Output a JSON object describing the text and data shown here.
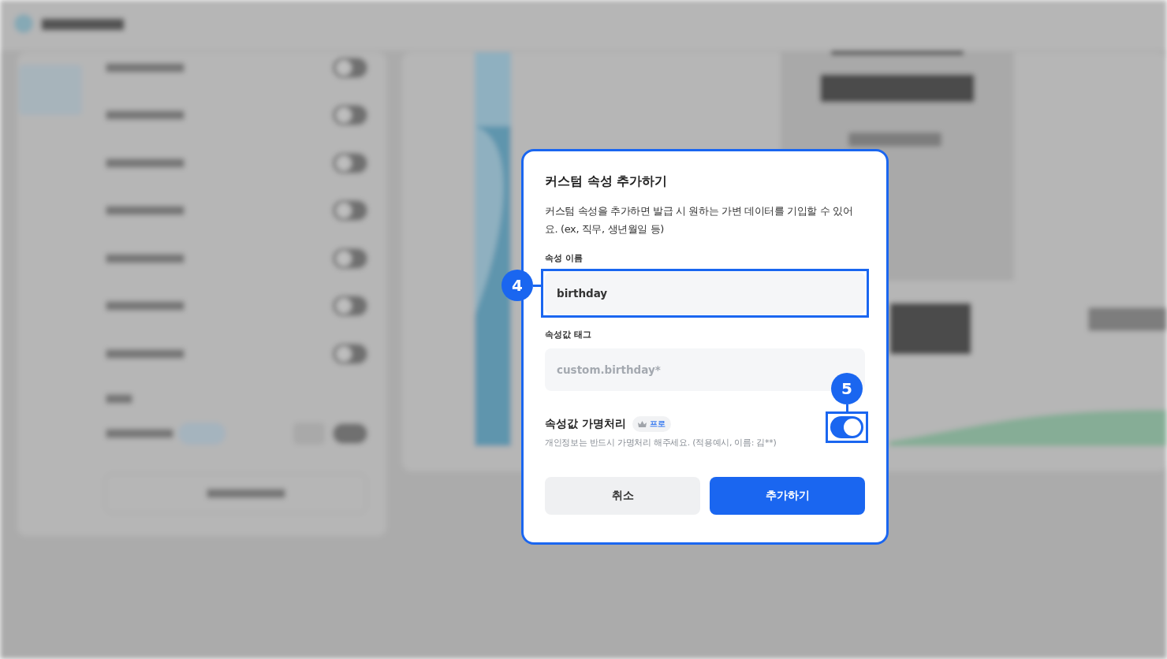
{
  "dialog": {
    "title": "커스텀 속성 추가하기",
    "description": "커스텀 속성을 추가하면 발급 시 원하는 가변 데이터를 기입할 수 있어요. (ex, 직무, 생년월일 등)",
    "fields": [
      {
        "label": "속성 이름",
        "value": "birthday",
        "highlighted": true,
        "step": "4"
      },
      {
        "label": "속성값 태그",
        "placeholder": "custom.birthday*",
        "highlighted": false
      }
    ],
    "pseudonymize": {
      "label": "속성값 가명처리",
      "badge": "프로",
      "hint": "개인정보는 반드시 가명처리 해주세요. (적용예시, 이름: 김**)",
      "on": true,
      "highlighted": true,
      "step": "5"
    },
    "buttons": [
      {
        "label": "취소",
        "kind": "secondary"
      },
      {
        "label": "추가하기",
        "kind": "primary"
      }
    ]
  }
}
